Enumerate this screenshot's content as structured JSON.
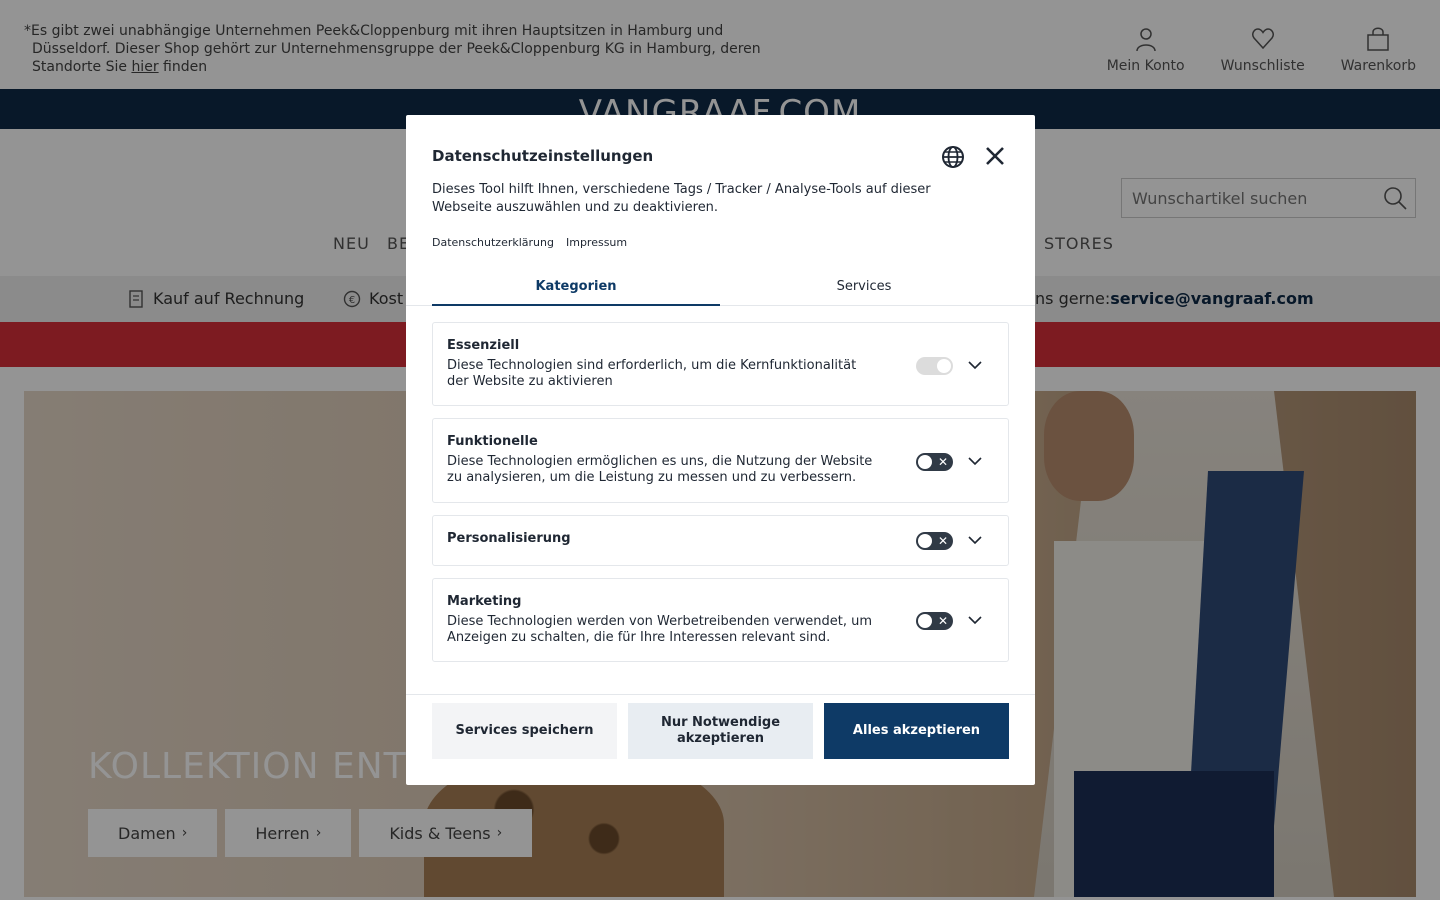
{
  "notice": {
    "line1": "*Es gibt zwei unabhängige Unternehmen Peek&Cloppenburg mit ihren Hauptsitzen in Hamburg und",
    "line2": "Düsseldorf. Dieser Shop gehört zur Unternehmensgruppe der Peek&Cloppenburg KG in Hamburg, deren",
    "line3_before": "Standorte Sie ",
    "line3_link": "hier",
    "line3_after": " finden"
  },
  "top_actions": [
    {
      "label": "Mein Konto",
      "icon": "user-icon"
    },
    {
      "label": "Wunschliste",
      "icon": "heart-icon"
    },
    {
      "label": "Warenkorb",
      "icon": "bag-icon"
    }
  ],
  "brand": {
    "logo": "VANGRAAF.COM"
  },
  "search": {
    "placeholder": "Wunschartikel suchen"
  },
  "nav": {
    "item_neu": "NEU",
    "item_be": "BE",
    "item_stores": "STORES"
  },
  "usp": {
    "invoice": "Kauf auf Rechnung",
    "cost_partial": "Kost",
    "contact_prefix": "ns gerne: ",
    "contact_email": "service@vangraaf.com"
  },
  "hero": {
    "title": "KOLLEKTION ENTD",
    "buttons": [
      "Damen",
      "Herren",
      "Kids & Teens"
    ]
  },
  "modal": {
    "title": "Datenschutzeinstellungen",
    "description": "Dieses Tool hilft Ihnen, verschiedene Tags / Tracker / Analyse-Tools auf dieser Webseite auszuwählen und zu deaktivieren.",
    "links": {
      "privacy": "Datenschutzerklärung",
      "imprint": "Impressum"
    },
    "tabs": {
      "categories": "Kategorien",
      "services": "Services"
    },
    "categories": [
      {
        "name": "Essenziell",
        "description": "Diese Technologien sind erforderlich, um die Kernfunktionalität der Website zu aktivieren",
        "enabled": true,
        "locked": true
      },
      {
        "name": "Funktionelle",
        "description": "Diese Technologien ermöglichen es uns, die Nutzung der Website zu analysieren, um die Leistung zu messen und zu verbessern.",
        "enabled": false,
        "locked": false
      },
      {
        "name": "Personalisierung",
        "description": "",
        "enabled": false,
        "locked": false
      },
      {
        "name": "Marketing",
        "description": "Diese Technologien werden von Werbetreibenden verwendet, um Anzeigen zu schalten, die für Ihre Interessen relevant sind.",
        "enabled": false,
        "locked": false
      }
    ],
    "buttons": {
      "save": "Services speichern",
      "necessary_line1": "Nur Notwendige",
      "necessary_line2": "akzeptieren",
      "accept_all": "Alles akzeptieren"
    }
  },
  "colors": {
    "brand_navy": "#0e2a48",
    "primary_button": "#0e3a66",
    "promo_red": "#d8303a"
  }
}
